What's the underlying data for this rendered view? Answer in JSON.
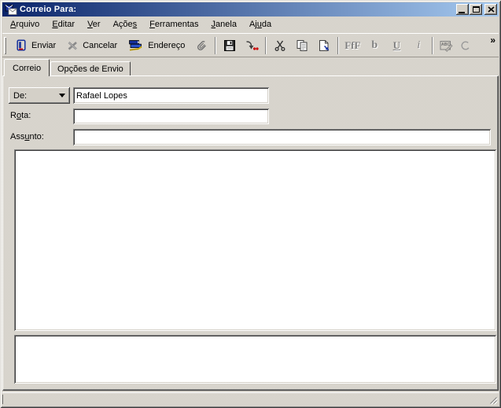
{
  "colors": {
    "face": "#d4d0c8",
    "title_gradient_start": "#0a246a",
    "title_gradient_end": "#a6caf0",
    "title_text": "#ffffff",
    "disabled_text": "#808080",
    "accent_red": "#cc0000",
    "accent_blue": "#16309c"
  },
  "window": {
    "title": "Correio Para:"
  },
  "menu": {
    "items": [
      {
        "pre": "",
        "accel": "A",
        "post": "rquivo"
      },
      {
        "pre": "",
        "accel": "E",
        "post": "ditar"
      },
      {
        "pre": "",
        "accel": "V",
        "post": "er"
      },
      {
        "pre": "Açõe",
        "accel": "s",
        "post": ""
      },
      {
        "pre": "",
        "accel": "F",
        "post": "erramentas"
      },
      {
        "pre": "",
        "accel": "J",
        "post": "anela"
      },
      {
        "pre": "Aj",
        "accel": "u",
        "post": "da"
      }
    ]
  },
  "toolbar": {
    "send_label": "Enviar",
    "cancel_label": "Cancelar",
    "address_label": "Endereço",
    "font_glyph": "FfF",
    "bold_glyph": "b",
    "underline_glyph": "U",
    "italic_glyph": "i",
    "spellcheck_glyph": "ABC",
    "overflow_glyph": "»"
  },
  "tabs": {
    "mail_label": "Correio",
    "send_options_label": "Opções de Envio"
  },
  "form": {
    "de_label": "De:",
    "de_value": "Rafael Lopes",
    "rota_label": {
      "pre": "R",
      "accel": "o",
      "post": "ta:"
    },
    "rota_value": "",
    "assunto_label": {
      "pre": "Ass",
      "accel": "u",
      "post": "nto:"
    },
    "assunto_value": "",
    "message_body": "",
    "attachments": ""
  },
  "icons": {
    "titlebar": "mail-envelope",
    "send": "mail-slot",
    "cancel": "gray-x",
    "address": "address-book-with-pen",
    "attach": "paperclip",
    "save": "floppy-disk",
    "route": "curved-arrow-red-dots",
    "cut": "scissors",
    "copy": "two-pages",
    "paste": "page-with-arrow",
    "spellcheck": "abc-pencil",
    "autocorrect": "open-circle",
    "dropdown": "down-triangle",
    "resize": "diagonal-grip"
  }
}
